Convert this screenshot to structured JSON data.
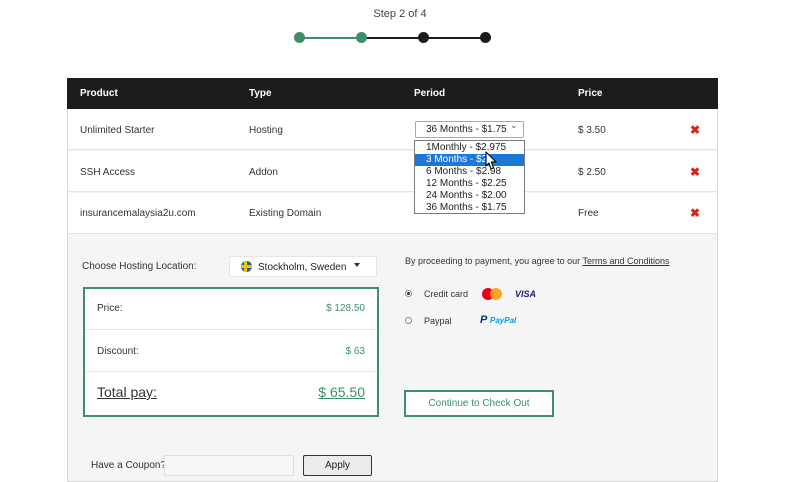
{
  "stepper": {
    "label": "Step 2 of 4",
    "colors": {
      "done": "#3e8e6a",
      "pending": "#1c1c1c"
    }
  },
  "table": {
    "headers": [
      "Product",
      "Type",
      "Period",
      "Price"
    ],
    "rows": [
      {
        "product": "Unlimited Starter",
        "type": "Hosting",
        "period": "36 Months - $1.75",
        "price": "$ 3.50"
      },
      {
        "product": "SSH Access",
        "type": "Addon",
        "period": "",
        "price": "$ 2.50"
      },
      {
        "product": "insurancemalaysia2u.com",
        "type": "Existing Domain",
        "period": "",
        "price": "Free"
      }
    ],
    "remove_icon": "close-icon"
  },
  "period_dropdown": {
    "selected": "36 Months - $1.75",
    "highlighted_index": 1,
    "options": [
      "1Monthly - $2.975",
      "3 Months - $2.",
      "6 Months - $2.98",
      "12 Months - $2.25",
      "24 Months - $2.00",
      "36 Months - $1.75"
    ]
  },
  "location": {
    "label": "Choose Hosting Location:",
    "value": "Stockholm, Sweden"
  },
  "summary": {
    "price_label": "Price:",
    "price_value": "$ 128.50",
    "discount_label": "Discount:",
    "discount_value": "$ 63",
    "total_label": "Total pay:",
    "total_value": "$ 65.50"
  },
  "payment": {
    "terms_prefix": "By proceeding to payment, you agree to our ",
    "terms_link": "Terms and Conditions",
    "methods": [
      {
        "label": "Credit card",
        "selected": true,
        "logos": [
          "MasterCard",
          "VISA"
        ]
      },
      {
        "label": "Paypal",
        "selected": false,
        "logos": [
          "PayPal"
        ]
      }
    ],
    "visa_text": "VISA",
    "paypal_mark": "P",
    "paypal_text": "PayPal",
    "checkout_label": "Continue to Check Out"
  },
  "coupon": {
    "label": "Have a Coupon?",
    "placeholder": "",
    "apply_label": "Apply"
  },
  "colors": {
    "accent": "#3e8e6a",
    "header": "#1c1c1c",
    "delete": "#d9251d",
    "highlight": "#1e78d8"
  }
}
